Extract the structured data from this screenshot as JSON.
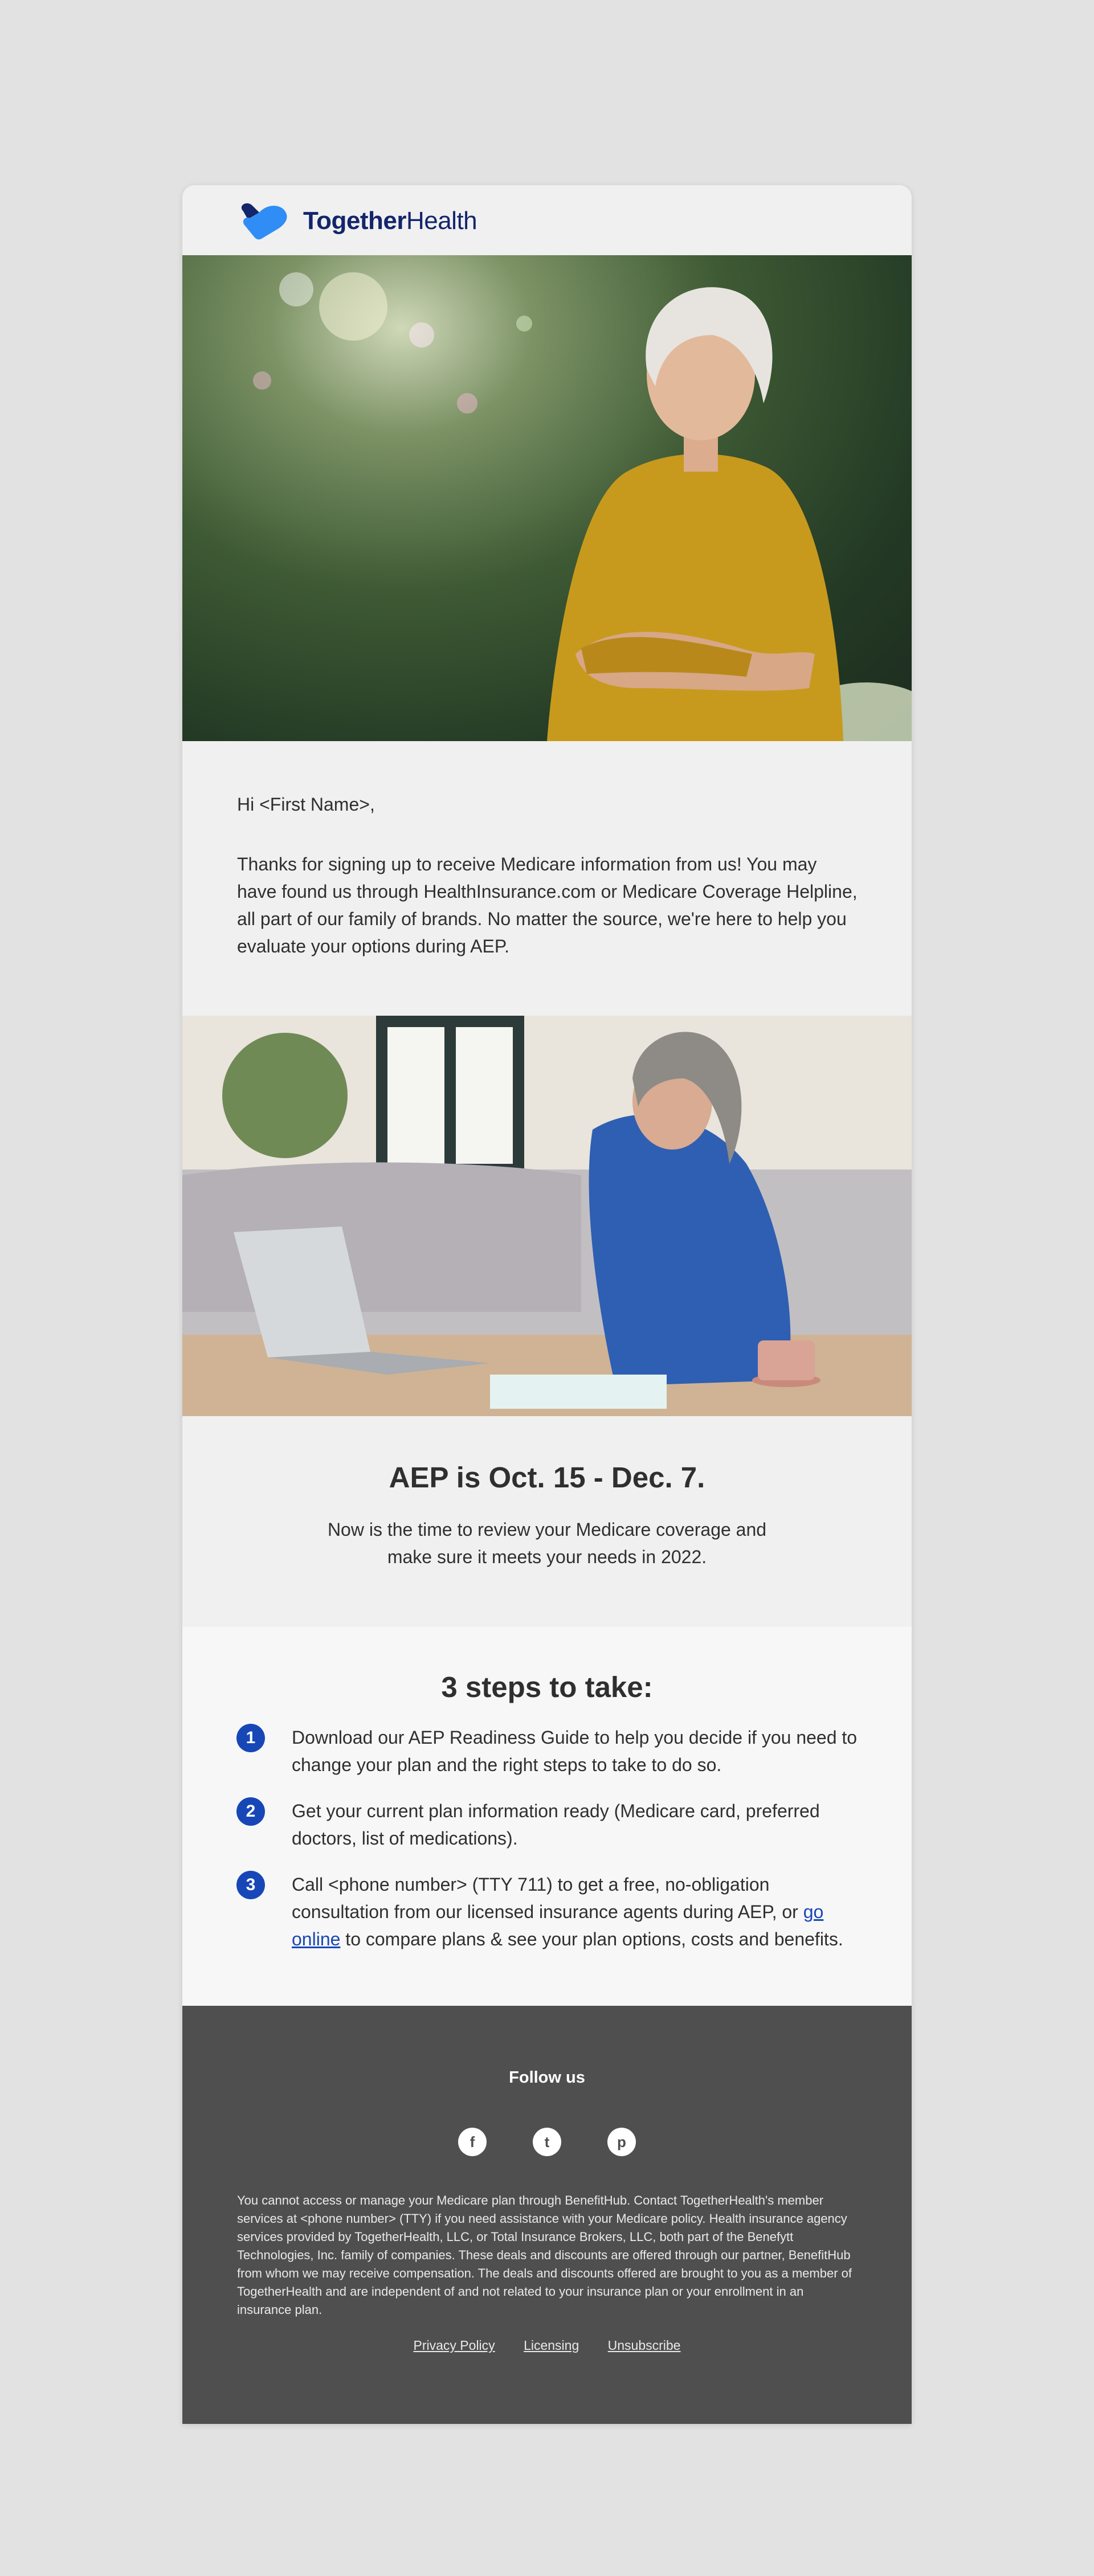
{
  "brand": {
    "name_bold": "Together",
    "name_regular": "Health"
  },
  "intro": {
    "greeting": "Hi <First Name>,",
    "body": "Thanks for signing up to receive Medicare information from us! You may have found us through HealthInsurance.com or Medicare Coverage Helpline, all part of our family of brands. No matter the source, we're here to help you evaluate your options during AEP."
  },
  "aep": {
    "title": "AEP is Oct. 15 - Dec. 7.",
    "body": "Now is the time to review your Medicare coverage and make sure it meets your needs in 2022."
  },
  "steps": {
    "title": "3 steps to take:",
    "items": [
      {
        "num": "1",
        "text": "Download our AEP Readiness Guide to help you decide if you need to change your plan and the right steps to take to do so."
      },
      {
        "num": "2",
        "text": "Get your current plan information ready (Medicare card, preferred doctors, list of medications)."
      },
      {
        "num": "3",
        "text_before": "Call <phone number> (TTY 711) to get a free, no-obligation consultation from our licensed insurance agents during AEP, or ",
        "link": "go online",
        "text_after": " to compare plans & see your plan options, costs and benefits."
      }
    ]
  },
  "footer": {
    "follow": "Follow us",
    "social": [
      {
        "icon": "facebook-icon",
        "glyph": "f"
      },
      {
        "icon": "twitter-icon",
        "glyph": "t"
      },
      {
        "icon": "pinterest-icon",
        "glyph": "p"
      }
    ],
    "disclaimer": "You cannot access or manage your Medicare plan through BenefitHub.  Contact TogetherHealth's member services at <phone number> (TTY) if you need assistance with your Medicare policy. Health insurance agency services provided by TogetherHealth, LLC, or Total Insurance Brokers, LLC, both part of the Benefytt Technologies, Inc. family of companies. These deals and discounts are offered through our partner, BenefitHub from whom we may receive compensation. The deals and discounts offered are brought to you as a member of TogetherHealth and are independent of and not related to your insurance plan or your enrollment in an insurance plan.",
    "links": {
      "privacy": "Privacy Policy",
      "licensing": "Licensing",
      "unsubscribe": "Unsubscribe"
    }
  },
  "colors": {
    "brand_navy": "#13256b",
    "brand_blue": "#2f8df5",
    "step_blue": "#1747b7",
    "footer_bg": "#4f4f4f"
  }
}
